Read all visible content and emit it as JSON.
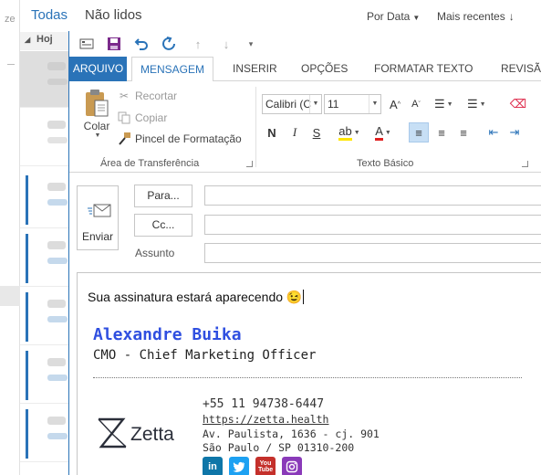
{
  "background": {
    "left_stub_letter": "ze",
    "filters": {
      "all": "Todas",
      "unread": "Não lidos"
    },
    "sort": {
      "by": "Por Data",
      "order": "Mais recentes"
    },
    "group_header": "Hoj",
    "colors": {
      "accent": "#2a73b8"
    }
  },
  "compose": {
    "tabs": {
      "file": "ARQUIVO",
      "message": "MENSAGEM",
      "insert": "INSERIR",
      "options": "OPÇÕES",
      "format": "FORMATAR TEXTO",
      "review": "REVISÃ"
    },
    "clipboard": {
      "paste": "Colar",
      "cut": "Recortar",
      "copy": "Copiar",
      "format_painter": "Pincel de Formatação",
      "group_label": "Área de Transferência"
    },
    "basic_text": {
      "font": "Calibri (C",
      "size": "11",
      "bold": "N",
      "italic": "I",
      "underline": "S",
      "group_label": "Texto Básico"
    },
    "fields": {
      "send": "Enviar",
      "to": "Para...",
      "cc": "Cc...",
      "subject": "Assunto",
      "to_value": "",
      "cc_value": "",
      "subject_value": ""
    },
    "body": {
      "intro": "Sua assinatura estará aparecendo 😉"
    },
    "signature": {
      "name": "Alexandre Buika",
      "title": "CMO - Chief Marketing Officer",
      "phone": "+55 11 94738-6447",
      "website": "https://zetta.health",
      "address_line1": "Av. Paulista, 1636 - cj. 901",
      "address_line2": "São Paulo / SP 01310-200",
      "logo_text": "Zetta",
      "social": {
        "linkedin": "in",
        "youtube": "You Tube"
      },
      "colors": {
        "name": "#2f4fe0",
        "linkedin": "#0e76a8",
        "twitter": "#1da1f2",
        "youtube": "#c4302b",
        "instagram": "#8a3ab9"
      }
    }
  }
}
